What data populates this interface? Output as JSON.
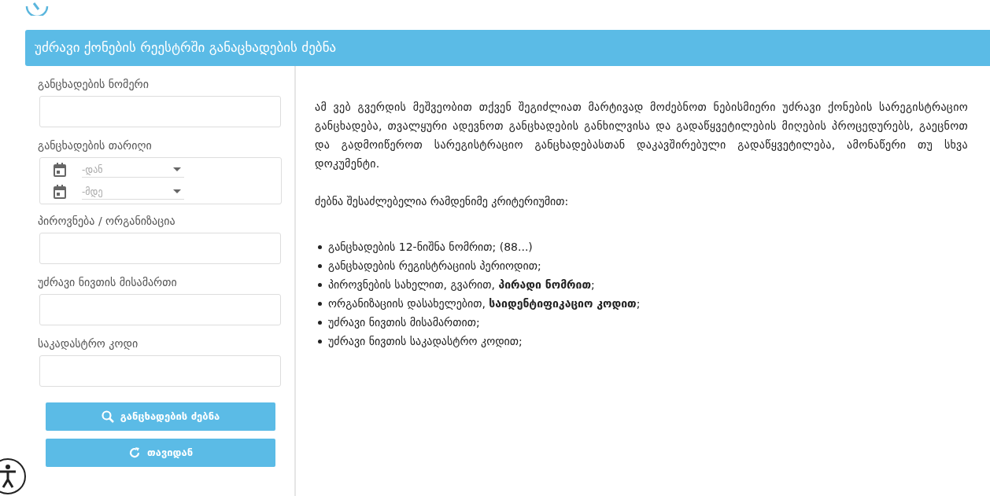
{
  "page_title": "უძრავი ქონების რეესტრში განაცხადების ძებნა",
  "form": {
    "fields": [
      {
        "kind": "text",
        "label": "განცხადების ნომერი"
      },
      {
        "kind": "daterange",
        "label": "განცხადების თარიღი",
        "from_placeholder": "-დან",
        "to_placeholder": "-მდე"
      },
      {
        "kind": "text",
        "label": "პიროვნება / ორგანიზაცია"
      },
      {
        "kind": "text",
        "label": "უძრავი ნივთის მისამართი"
      },
      {
        "kind": "text",
        "label": "საკადასტრო კოდი"
      }
    ],
    "buttons": [
      {
        "kind": "search",
        "label": "განცხადების ძებნა"
      },
      {
        "kind": "reset",
        "label": "თავიდან"
      }
    ]
  },
  "intro": "ამ ვებ გვერდის მეშვეობით თქვენ შეგიძლიათ მარტივად მოძებნოთ ნებისმიერი უძრავი ქონების სარეგისტრაციო განცხადება, თვალყური ადევნოთ განცხადების განხილვისა და გადაწყვეტილების მიღების პროცედურებს, გაეცნოთ და გადმოიწეროთ სარეგისტრაციო განცხადებასთან დაკავშირებული გადაწყვეტილება, ამონაწერი თუ სხვა დოკუმენტი.",
  "criteria_heading": "ძებნა შესაძლებელია რამდენიმე კრიტერიუმით:",
  "criteria": [
    "განცხადების 12-ნიშნა ნომრით; (88...)",
    "განცხადების რეგისტრაციის პერიოდით;",
    "პიროვნების სახელით, გვარით, **პირადი ნომრით**;",
    "ორგანიზაციის დასახელებით, **საიდენტიფიკაციო კოდით**;",
    "უძრავი ნივთის მისამართით;",
    "უძრავი ნივთის საკადასტრო კოდით;"
  ]
}
